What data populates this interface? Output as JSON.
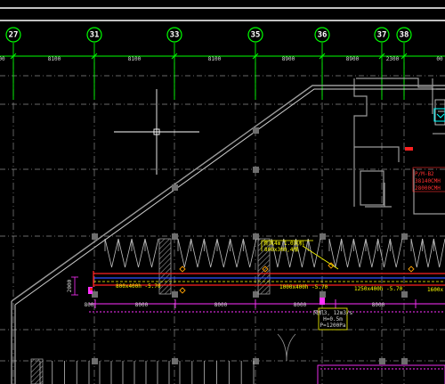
{
  "grid_axes": [
    {
      "label": "27"
    },
    {
      "label": "31"
    },
    {
      "label": "33"
    },
    {
      "label": "35"
    },
    {
      "label": "36"
    },
    {
      "label": "37"
    },
    {
      "label": "38"
    }
  ],
  "top_dimensions": [
    "00",
    "8100",
    "8100",
    "8100",
    "8900",
    "8900",
    "2300",
    "00"
  ],
  "duct_labels": [
    "800x400h -5.70",
    "1000x400h -5.70",
    "1250x400h -5.70",
    "1600x"
  ],
  "elevation_mark": "2000",
  "bottom_dimensions": [
    "800",
    "8000",
    "8000",
    "8000",
    "8000"
  ],
  "callout_yellow": {
    "line1": "新风4m 1.0风机",
    "line2": "800x300,4根"
  },
  "callout_white": {
    "line1": "风机3, 12m3/s",
    "line2": "H=0.5m",
    "line3": "P=1200Pa"
  },
  "room_tag_red": {
    "line1": "P/M-B2",
    "line2": "38140CMH",
    "line3": "28000CMH"
  },
  "colors": {
    "background": "#000000",
    "grid_axis_green": "#00ff00",
    "wall_gray": "#9a9a9a",
    "duct_red": "#ff2020",
    "duct_blue": "#3050ff",
    "leader_yellow": "#ffff00",
    "magenta": "#ff30ff",
    "cyan_equipment": "#00ffff"
  }
}
